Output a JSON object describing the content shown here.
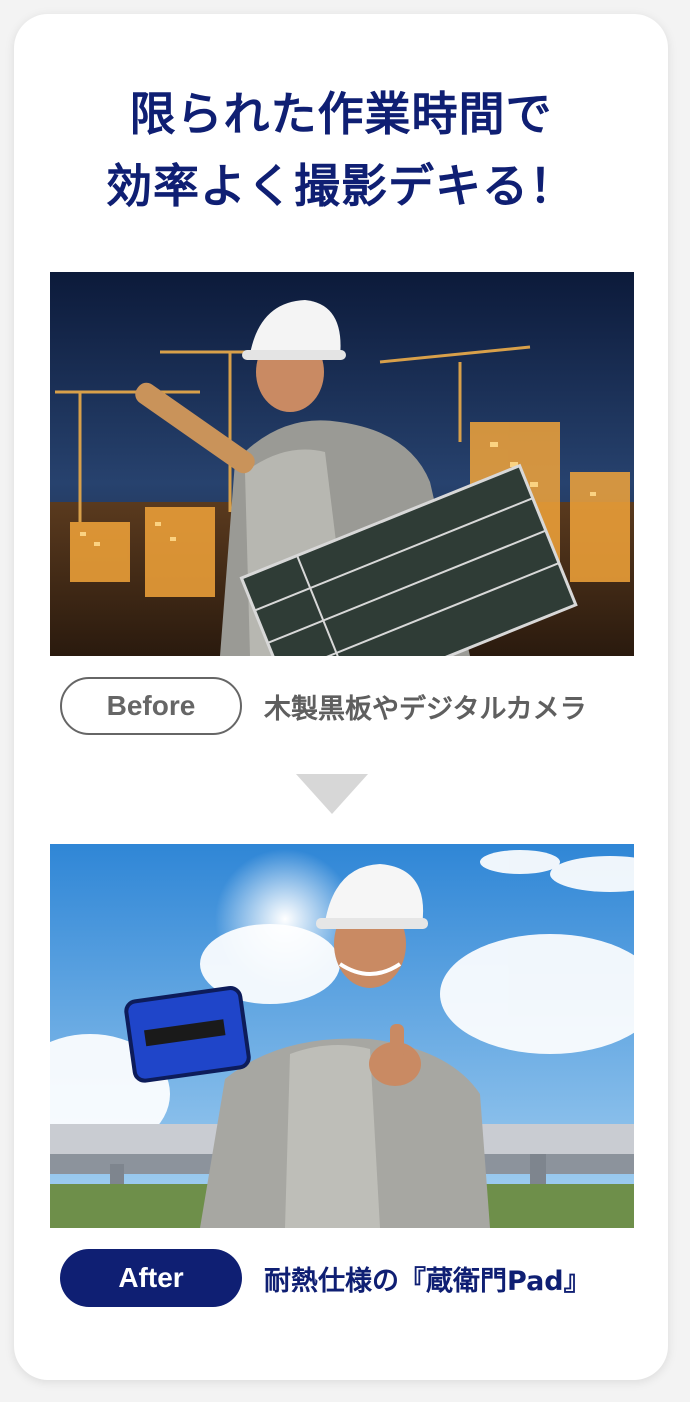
{
  "headline": {
    "line1": "限られた作業時間で",
    "line2": "効率よく撮影デキる！"
  },
  "before": {
    "pill_label": "Before",
    "caption": "木製黒板やデジタルカメラ"
  },
  "after": {
    "pill_label": "After",
    "caption": "耐熱仕様の『蔵衛門Pad』"
  },
  "colors": {
    "brand_navy": "#0f1f73",
    "before_gray": "#666666",
    "arrow_gray": "#d7d7d7"
  }
}
